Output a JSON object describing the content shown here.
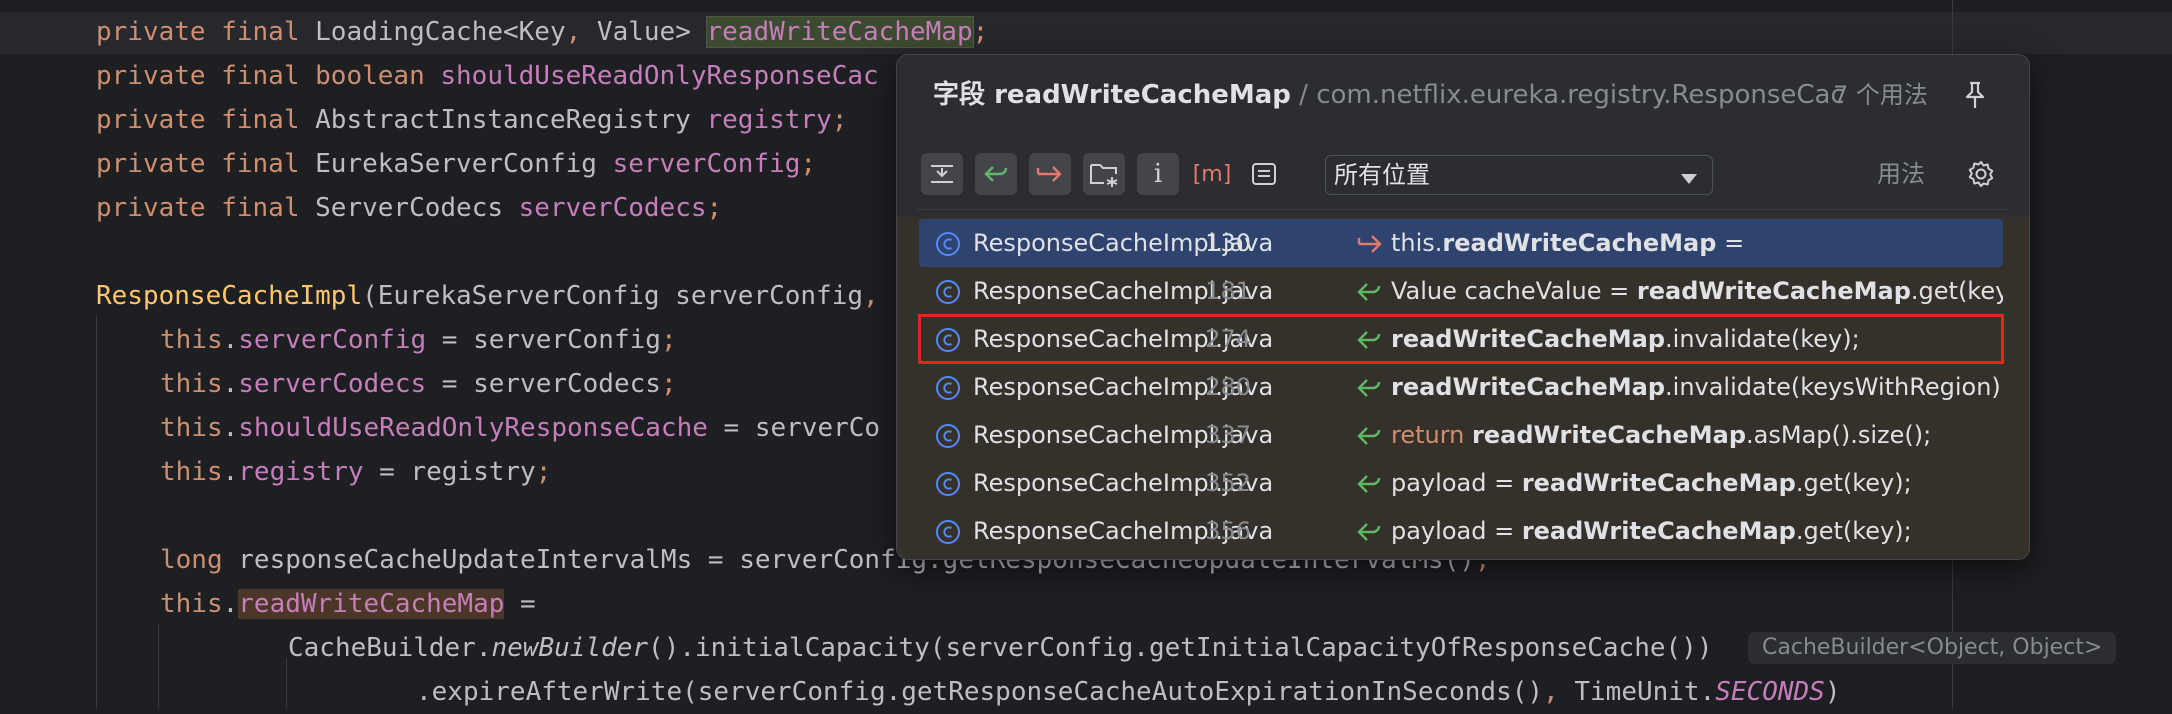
{
  "editor": {
    "lines": [
      {
        "t": [
          [
            "kw",
            "private final "
          ],
          [
            "",
            "LoadingCache<Key"
          ],
          [
            "kw",
            ", "
          ],
          [
            "",
            "Value> "
          ],
          [
            "fld hl-def",
            "readWriteCacheMap"
          ],
          [
            "kw",
            ";"
          ]
        ]
      },
      {
        "t": [
          [
            "kw",
            "private final boolean "
          ],
          [
            "fld",
            "shouldUseReadOnlyResponseCac"
          ]
        ]
      },
      {
        "t": [
          [
            "kw",
            "private final "
          ],
          [
            "",
            "AbstractInstanceRegistry "
          ],
          [
            "fld",
            "registry"
          ],
          [
            "kw",
            ";"
          ]
        ]
      },
      {
        "t": [
          [
            "kw",
            "private final "
          ],
          [
            "",
            "EurekaServerConfig "
          ],
          [
            "fld",
            "serverConfig"
          ],
          [
            "kw",
            ";"
          ]
        ]
      },
      {
        "t": [
          [
            "kw",
            "private final "
          ],
          [
            "",
            "ServerCodecs "
          ],
          [
            "fld",
            "serverCodecs"
          ],
          [
            "kw",
            ";"
          ]
        ]
      },
      {
        "t": []
      },
      {
        "t": [
          [
            "fn",
            "ResponseCacheImpl"
          ],
          [
            "",
            "(EurekaServerConfig serverConfig"
          ],
          [
            "kw",
            ","
          ]
        ]
      },
      {
        "t": [
          [
            "kw",
            "this"
          ],
          [
            "",
            "."
          ],
          [
            "fld",
            "serverConfig"
          ],
          [
            "",
            " = serverConfig"
          ],
          [
            "kw",
            ";"
          ]
        ]
      },
      {
        "t": [
          [
            "kw",
            "this"
          ],
          [
            "",
            "."
          ],
          [
            "fld",
            "serverCodecs"
          ],
          [
            "",
            " = serverCodecs"
          ],
          [
            "kw",
            ";"
          ]
        ]
      },
      {
        "t": [
          [
            "kw",
            "this"
          ],
          [
            "",
            "."
          ],
          [
            "fld",
            "shouldUseReadOnlyResponseCache"
          ],
          [
            "",
            " = serverCo"
          ]
        ]
      },
      {
        "t": [
          [
            "kw",
            "this"
          ],
          [
            "",
            "."
          ],
          [
            "fld",
            "registry"
          ],
          [
            "",
            " = registry"
          ],
          [
            "kw",
            ";"
          ]
        ]
      },
      {
        "t": []
      },
      {
        "t": [
          [
            "kw",
            "long "
          ],
          [
            "",
            "responseCacheUpdateIntervalMs = serverConfig.getResponseCacheUpdateIntervalMs()"
          ],
          [
            "kw",
            ";"
          ]
        ]
      },
      {
        "t": [
          [
            "kw",
            "this"
          ],
          [
            "",
            "."
          ],
          [
            "fld hl-use",
            "readWriteCacheMap"
          ],
          [
            "",
            " ="
          ]
        ]
      },
      {
        "t": [
          [
            "",
            "CacheBuilder."
          ],
          [
            "it",
            "newBuilder"
          ],
          [
            "",
            "().initialCapacity(serverConfig.getInitialCapacityOfResponseCache())"
          ]
        ]
      },
      {
        "t": [
          [
            "",
            ".expireAfterWrite(serverConfig.getResponseCacheAutoExpirationInSeconds()"
          ],
          [
            "kw",
            ", "
          ],
          [
            "",
            "TimeUnit."
          ],
          [
            "st",
            "SECONDS"
          ],
          [
            "",
            ")"
          ]
        ]
      }
    ],
    "inlay_hint": "CacheBuilder<Object, Object>"
  },
  "popup": {
    "title_prefix": "字段 ",
    "title_field": "readWriteCacheMap",
    "title_sep": " / ",
    "title_path": "com.netflix.eureka.registry.ResponseCacheImpl",
    "usage_count": "7 个用法",
    "scope": "所有位置",
    "usages_link": "用法",
    "icons": {
      "pin": "pin-icon",
      "gear": "gear-icon",
      "toolbar": [
        "merge-lines-icon",
        "read-access-icon",
        "write-access-icon",
        "folder-scope-icon",
        "info-icon",
        "brackets-icon",
        "preview-icon"
      ]
    },
    "results": [
      {
        "file": "ResponseCacheImpl.java",
        "line": "130",
        "kind": "write",
        "pre": "this.",
        "bold": "readWriteCacheMap",
        "post": " =",
        "selected": true
      },
      {
        "file": "ResponseCacheImpl.java",
        "line": "181",
        "kind": "read",
        "pre": "Value cacheValue = ",
        "bold": "readWriteCacheMap",
        "post": ".get(key)"
      },
      {
        "file": "ResponseCacheImpl.java",
        "line": "274",
        "kind": "read",
        "pre": "",
        "bold": "readWriteCacheMap",
        "post": ".invalidate(key);",
        "boxed": true
      },
      {
        "file": "ResponseCacheImpl.java",
        "line": "280",
        "kind": "read",
        "pre": "",
        "bold": "readWriteCacheMap",
        "post": ".invalidate(keysWithRegion)"
      },
      {
        "file": "ResponseCacheImpl.java",
        "line": "337",
        "kind": "read",
        "kw": "return ",
        "pre": "",
        "bold": "readWriteCacheMap",
        "post": ".asMap().size();"
      },
      {
        "file": "ResponseCacheImpl.java",
        "line": "352",
        "kind": "read",
        "pre": "payload = ",
        "bold": "readWriteCacheMap",
        "post": ".get(key);"
      },
      {
        "file": "ResponseCacheImpl.java",
        "line": "356",
        "kind": "read",
        "pre": "payload = ",
        "bold": "readWriteCacheMap",
        "post": ".get(key);"
      }
    ]
  },
  "colors": {
    "selection": "#2e436e",
    "highlight_box": "#e3251f",
    "write_arrow": "#e2796a",
    "read_arrow": "#5fb865",
    "class_icon": "#548af7"
  }
}
